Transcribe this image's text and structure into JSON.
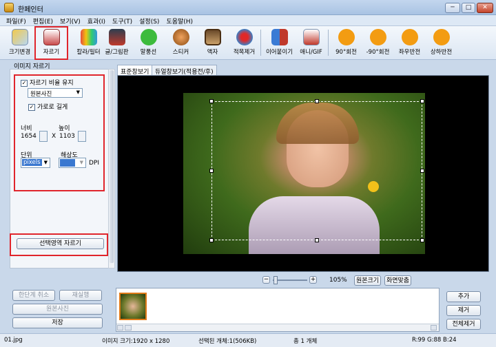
{
  "window": {
    "title": "한페인터",
    "btn_min": "─",
    "btn_max": "□",
    "btn_close": "✕"
  },
  "menu": [
    "파일(F)",
    "편집(E)",
    "보기(V)",
    "효과(I)",
    "도구(T)",
    "설정(S)",
    "도움말(H)"
  ],
  "toolbar": {
    "resize": "크기변경",
    "crop": "자르기",
    "color": "칼라/필터",
    "text": "글/그림판",
    "bubble": "말풍선",
    "sticker": "스티커",
    "frame": "액자",
    "redeye": "적목제거",
    "join": "이어붙이기",
    "gif": "애니/GIF",
    "rot90": "90°회전",
    "rotm90": "-90°회전",
    "fliph": "좌우반전",
    "flipv": "상하반전"
  },
  "crop_panel": {
    "title": "이미지 자르기",
    "keep_ratio_label": "자르기 비율 유지",
    "ratio_select": "원본사진",
    "landscape_label": "가로로 길게",
    "width_label": "너비",
    "width_value": "1654",
    "height_label": "높이",
    "height_value": "1103",
    "x_sep": "X",
    "unit_label": "단위",
    "unit_value": "pixels",
    "resolution_label": "해상도",
    "dpi_label": "DPI",
    "crop_button": "선택영역 자르기"
  },
  "view_tabs": {
    "standard": "표준창보기",
    "dual": "듀얼창보기(적용전/후)"
  },
  "zoom": {
    "minus": "−",
    "plus": "+",
    "percent": "105%",
    "original": "원본크기",
    "fit": "화면맞춤"
  },
  "actions": {
    "undo": "한단계 취소",
    "redo": "재실행",
    "original": "원본사진",
    "save": "저장"
  },
  "list_buttons": {
    "add": "추가",
    "remove": "제거",
    "remove_all": "전체제거"
  },
  "status": {
    "filename": "01.jpg",
    "image_size": "이미지 크기:1920 x 1280",
    "selected": "선택된 개체:1(506KB)",
    "total": "총 1 개체",
    "rgb": "R:99 G:88 B:24"
  },
  "colors": {
    "accent_red": "#e0242b",
    "canvas_bg": "#000000",
    "window_bg": "#c9d8ea"
  }
}
